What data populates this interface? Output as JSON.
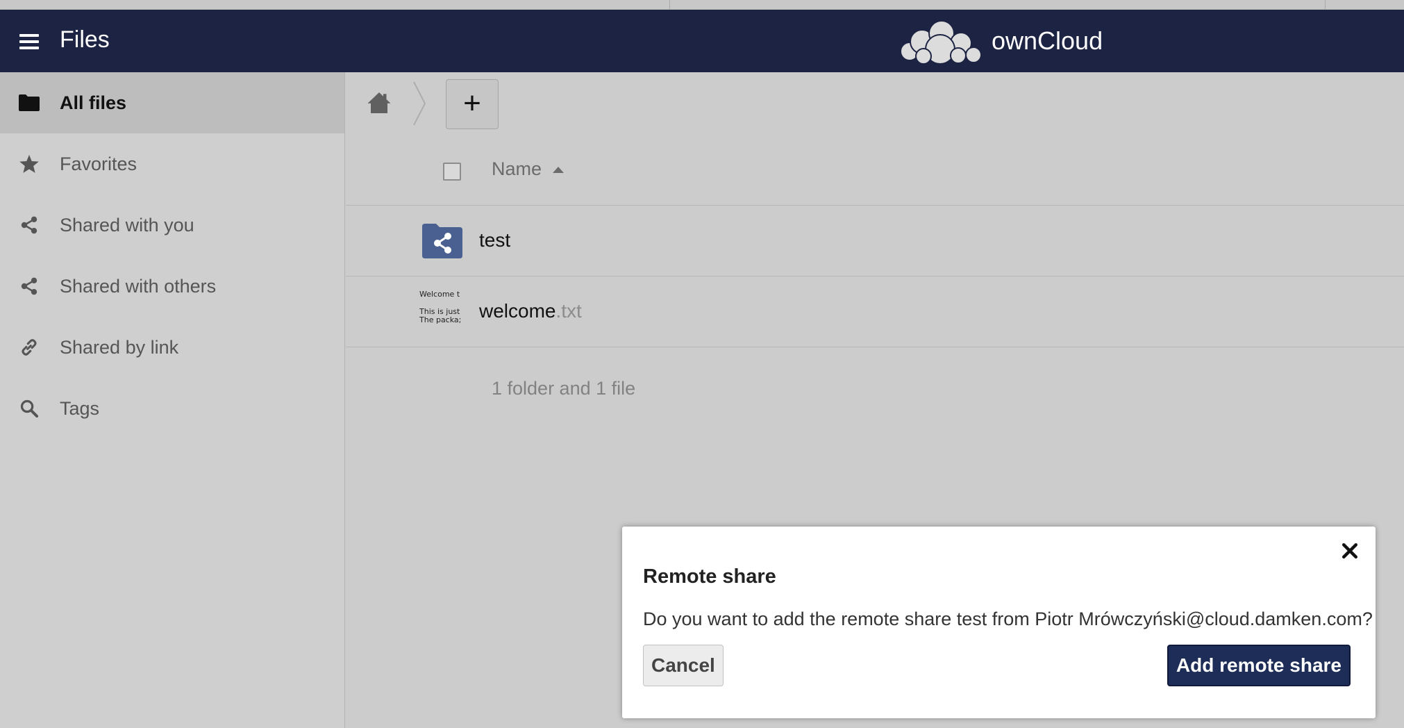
{
  "header": {
    "app_title": "Files",
    "brand_name": "ownCloud",
    "menu_icon": "hamburger-menu-icon",
    "logo_icon": "owncloud-cloud-logo",
    "background_color": "#1d2342"
  },
  "sidebar": {
    "items": [
      {
        "label": "All files",
        "icon": "folder-icon",
        "active": true
      },
      {
        "label": "Favorites",
        "icon": "star-icon",
        "active": false
      },
      {
        "label": "Shared with you",
        "icon": "share-icon",
        "active": false
      },
      {
        "label": "Shared with others",
        "icon": "share-icon",
        "active": false
      },
      {
        "label": "Shared by link",
        "icon": "link-icon",
        "active": false
      },
      {
        "label": "Tags",
        "icon": "search-icon",
        "active": false
      }
    ]
  },
  "toolbar": {
    "home_icon": "home-icon",
    "new_button_label": "+"
  },
  "file_list": {
    "column_name": "Name",
    "sort_direction": "ascending",
    "files": [
      {
        "name": "test",
        "extension": "",
        "type": "shared-folder",
        "icon": "shared-folder-icon"
      },
      {
        "name": "welcome",
        "extension": ".txt",
        "type": "text-file",
        "preview_lines": [
          "Welcome t",
          "This is just",
          "The packa;"
        ]
      }
    ],
    "summary": "1 folder and 1 file"
  },
  "dialog": {
    "title": "Remote share",
    "message": "Do you want to add the remote share test from Piotr Mrówczyński@cloud.damken.com?",
    "cancel_label": "Cancel",
    "confirm_label": "Add remote share",
    "confirm_color": "#1d2d57"
  }
}
